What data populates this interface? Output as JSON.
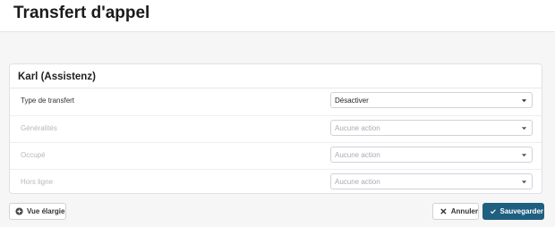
{
  "header": {
    "title": "Transfert d'appel"
  },
  "card": {
    "title": "Karl (Assistenz)",
    "rows": [
      {
        "label": "Type de transfert",
        "value": "Désactiver",
        "muted": false
      },
      {
        "label": "Généralités",
        "value": "Aucune action",
        "muted": true
      },
      {
        "label": "Occupé",
        "value": "Aucune action",
        "muted": true
      },
      {
        "label": "Hors ligne",
        "value": "Aucune action",
        "muted": true
      }
    ]
  },
  "footer": {
    "expand_label": "Vue élargie",
    "cancel_label": "Annuler",
    "save_label": "Sauvegarder"
  },
  "icons": {
    "expand": "plus-circle-icon",
    "cancel": "close-icon",
    "save": "checkmark-icon",
    "select": "caret-down-icon"
  },
  "colors": {
    "primary": "#1f5f80",
    "muted_text": "#b6b8bd"
  }
}
